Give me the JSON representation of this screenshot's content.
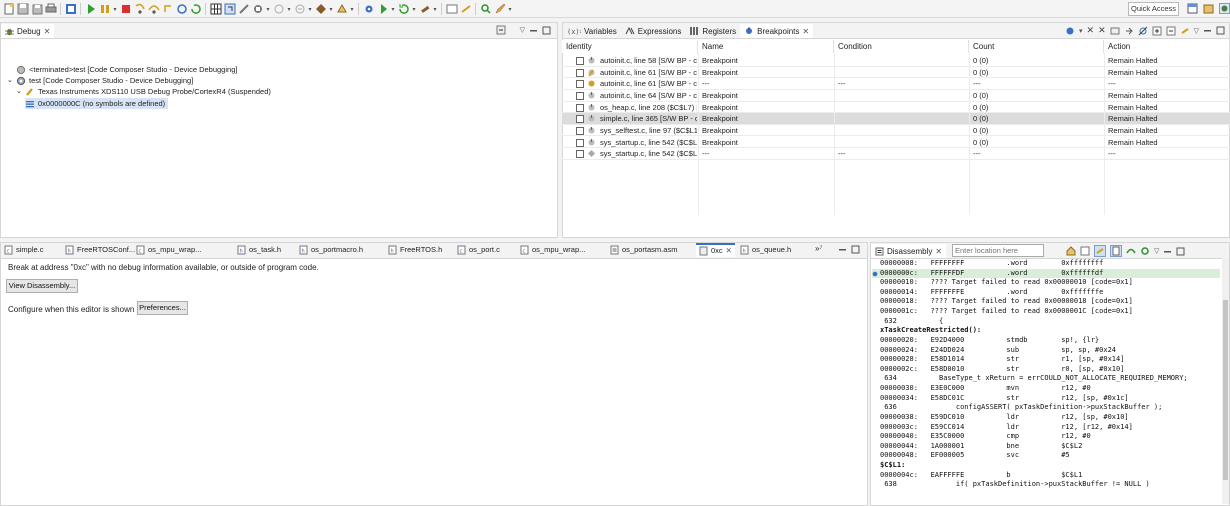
{
  "toolbar": {
    "icons": [
      "new-icon",
      "save-icon",
      "save-all-icon",
      "print-icon",
      "debug-view-icon",
      "resume-icon",
      "suspend-icon",
      "terminate-icon",
      "step-into-icon",
      "step-over-icon",
      "step-return-icon",
      "reset-icon",
      "restart-icon",
      "grid-icon",
      "instruction-step-icon",
      "connect-icon",
      "breakpoint-icon",
      "skip-breakpoints-icon",
      "memory-icon",
      "load-program-icon",
      "open-perspective-icon",
      "gear-icon",
      "run-icon",
      "refresh-icon",
      "build-icon",
      "window-icon",
      "link-icon",
      "search-icon",
      "edit-icon"
    ],
    "quick_access": "Quick Access"
  },
  "debug_view": {
    "tab_label": "Debug",
    "tree": [
      {
        "label": "<terminated>test [Code Composer Studio - Device Debugging]",
        "level": 0,
        "icon": "terminated-icon"
      },
      {
        "label": "test [Code Composer Studio - Device Debugging]",
        "level": 0,
        "icon": "launch-icon"
      },
      {
        "label": "Texas Instruments XDS110 USB Debug Probe/CortexR4 (Suspended)",
        "level": 1,
        "icon": "probe-icon"
      },
      {
        "label": "0x0000000C  (no symbols are defined)",
        "level": 2,
        "icon": "stack-frame-icon",
        "selected": true
      }
    ]
  },
  "right_view": {
    "tabs": [
      {
        "label": "Variables",
        "icon": "variables-icon"
      },
      {
        "label": "Expressions",
        "icon": "expressions-icon"
      },
      {
        "label": "Registers",
        "icon": "registers-icon"
      },
      {
        "label": "Breakpoints",
        "icon": "breakpoints-icon",
        "active": true
      }
    ],
    "columns": [
      "Identity",
      "Name",
      "Condition",
      "Count",
      "Action"
    ],
    "rows": [
      {
        "identity": "autoinit.c, line 58 [S/W BP - c",
        "name": "Breakpoint",
        "condition": "",
        "count": "0 (0)",
        "action": "Remain Halted"
      },
      {
        "identity": "autoinit.c, line 61 [S/W BP - c",
        "name": "Breakpoint",
        "condition": "",
        "count": "0 (0)",
        "action": "Remain Halted"
      },
      {
        "identity": "autoinit.c, line 61 [S/W BP - c",
        "name": "---",
        "condition": "---",
        "count": "---",
        "action": "---"
      },
      {
        "identity": "autoinit.c, line 64 [S/W BP - c",
        "name": "Breakpoint",
        "condition": "",
        "count": "0 (0)",
        "action": "Remain Halted"
      },
      {
        "identity": "os_heap.c, line 208 ($C$L7)  [",
        "name": "Breakpoint",
        "condition": "",
        "count": "0 (0)",
        "action": "Remain Halted"
      },
      {
        "identity": "simple.c, line 365 [S/W BP - c",
        "name": "Breakpoint",
        "condition": "",
        "count": "0 (0)",
        "action": "Remain Halted",
        "selected": true
      },
      {
        "identity": "sys_selftest.c, line 97 ($C$L1",
        "name": "Breakpoint",
        "condition": "",
        "count": "0 (0)",
        "action": "Remain Halted"
      },
      {
        "identity": "sys_startup.c, line 542 ($C$L1",
        "name": "Breakpoint",
        "condition": "",
        "count": "0 (0)",
        "action": "Remain Halted"
      },
      {
        "identity": "sys_startup.c, line 542 ($C$L1",
        "name": "---",
        "condition": "---",
        "count": "---",
        "action": "---"
      }
    ]
  },
  "editor": {
    "tabs": [
      {
        "label": "simple.c",
        "icon": "c-file-icon"
      },
      {
        "label": "FreeRTOSConf...",
        "icon": "h-file-icon"
      },
      {
        "label": "os_mpu_wrap...",
        "icon": "c-file-icon"
      },
      {
        "label": "os_task.h",
        "icon": "h-file-icon"
      },
      {
        "label": "os_portmacro.h",
        "icon": "h-file-icon"
      },
      {
        "label": "FreeRTOS.h",
        "icon": "h-file-icon"
      },
      {
        "label": "os_port.c",
        "icon": "c-file-icon"
      },
      {
        "label": "os_mpu_wrap...",
        "icon": "c-file-icon"
      },
      {
        "label": "os_portasm.asm",
        "icon": "asm-file-icon"
      },
      {
        "label": "0xc",
        "icon": "address-icon",
        "active": true
      },
      {
        "label": "os_queue.h",
        "icon": "h-file-icon"
      }
    ],
    "overflow": "»⁷",
    "message": "Break at address \"0xc\" with no debug information available, or outside of program code.",
    "view_disassembly_button": "View Disassembly...",
    "configure_label": "Configure when this editor is shown",
    "preferences_button": "Preferences..."
  },
  "disassembly": {
    "tab_label": "Disassembly",
    "location_placeholder": "Enter location here",
    "lines": [
      {
        "text": "00000008:   FFFFFFFF          .word        0xffffffff"
      },
      {
        "text": "0000000c:   FFFFFFDF          .word        0xffffffdf",
        "current": true
      },
      {
        "text": "00000010:   ???? Target failed to read 0x00000010 [code=0x1]"
      },
      {
        "text": "00000014:   FFFFFFFE          .word        0xfffffffe"
      },
      {
        "text": "00000018:   ???? Target failed to read 0x00000018 [code=0x1]"
      },
      {
        "text": "0000001c:   ???? Target failed to read 0x0000001C [code=0x1]"
      },
      {
        "text": " 632          {"
      },
      {
        "text": "xTaskCreateRestricted():",
        "bold": true
      },
      {
        "text": "00000020:   E92D4000          stmdb        sp!, {lr}"
      },
      {
        "text": "00000024:   E24DD024          sub          sp, sp, #0x24"
      },
      {
        "text": "00000028:   E58D1014          str          r1, [sp, #0x14]"
      },
      {
        "text": "0000002c:   E58D0010          str          r0, [sp, #0x10]"
      },
      {
        "text": " 634          BaseType_t xReturn = errCOULD_NOT_ALLOCATE_REQUIRED_MEMORY;"
      },
      {
        "text": "00000030:   E3E0C000          mvn          r12, #0"
      },
      {
        "text": "00000034:   E58DC01C          str          r12, [sp, #0x1c]"
      },
      {
        "text": " 636              configASSERT( pxTaskDefinition->puxStackBuffer );"
      },
      {
        "text": "00000038:   E59DC010          ldr          r12, [sp, #0x10]"
      },
      {
        "text": "0000003c:   E59CC014          ldr          r12, [r12, #0x14]"
      },
      {
        "text": "00000040:   E35C0000          cmp          r12, #0"
      },
      {
        "text": "00000044:   1A000001          bne          $C$L2"
      },
      {
        "text": "00000048:   EF000005          svc          #5"
      },
      {
        "text": "$C$L1:",
        "bold": true
      },
      {
        "text": "0000004c:   EAFFFFFE          b            $C$L1"
      },
      {
        "text": " 638              if( pxTaskDefinition->puxStackBuffer != NULL )"
      }
    ]
  }
}
